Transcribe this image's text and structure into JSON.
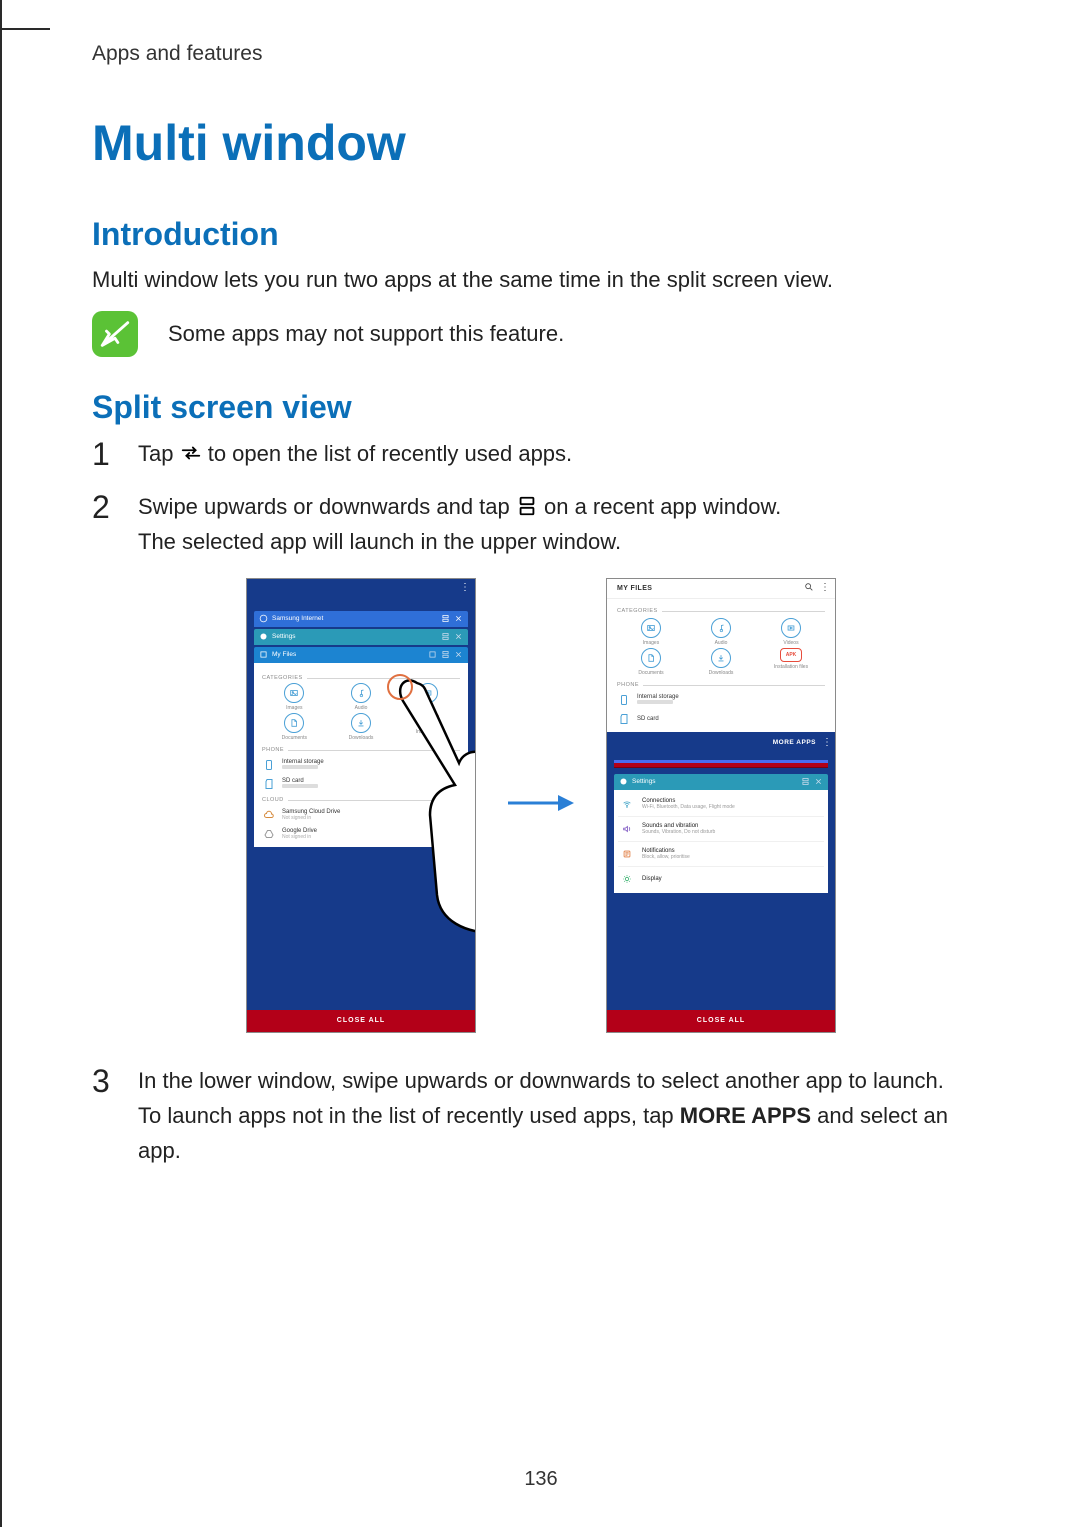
{
  "breadcrumb": "Apps and features",
  "page_title": "Multi window",
  "intro": {
    "heading": "Introduction",
    "body": "Multi window lets you run two apps at the same time in the split screen view.",
    "note": "Some apps may not support this feature."
  },
  "split": {
    "heading": "Split screen view",
    "steps": {
      "1": {
        "num": "1",
        "pre": "Tap ",
        "post": " to open the list of recently used apps."
      },
      "2": {
        "num": "2",
        "pre": "Swipe upwards or downwards and tap ",
        "post": " on a recent app window.",
        "body2": "The selected app will launch in the upper window."
      },
      "3": {
        "num": "3",
        "body1": "In the lower window, swipe upwards or downwards to select another app to launch.",
        "body2": "To launch apps not in the list of recently used apps, tap ",
        "bold": "MORE APPS",
        "body2b": " and select an app."
      }
    }
  },
  "phone_a": {
    "recents": {
      "r1": "Samsung Internet",
      "r2": "Settings",
      "r3": "My Files"
    },
    "categories_label": "CATEGORIES",
    "cats": [
      "Images",
      "Audio",
      "Vide",
      "Documents",
      "Downloads",
      "Installation"
    ],
    "apk_label": "APK",
    "phone_label": "PHONE",
    "phone_rows": {
      "internal": {
        "title": "Internal storage"
      },
      "sd": {
        "title": "SD card"
      }
    },
    "cloud_label": "CLOUD",
    "cloud_rows": {
      "scd": {
        "title": "Samsung Cloud Drive",
        "sub": "Not signed in"
      },
      "gd": {
        "title": "Google Drive",
        "sub": "Not signed in"
      }
    },
    "close_all": "CLOSE ALL"
  },
  "phone_b": {
    "topbar_title": "MY FILES",
    "categories_label": "CATEGORIES",
    "cats": [
      "Images",
      "Audio",
      "Videos",
      "Documents",
      "Downloads",
      "Installation files"
    ],
    "apk_label": "APK",
    "phone_label": "PHONE",
    "phone_rows": {
      "internal": {
        "title": "Internal storage"
      },
      "sd": {
        "title": "SD card"
      }
    },
    "more_apps": "MORE APPS",
    "settings_card": "Settings",
    "settings": {
      "connections": {
        "title": "Connections",
        "sub": "Wi-Fi, Bluetooth, Data usage, Flight mode"
      },
      "sounds": {
        "title": "Sounds and vibration",
        "sub": "Sounds, Vibration, Do not disturb"
      },
      "notifications": {
        "title": "Notifications",
        "sub": "Block, allow, prioritise"
      },
      "display": {
        "title": "Display"
      }
    },
    "close_all": "CLOSE ALL"
  },
  "page_number": "136"
}
